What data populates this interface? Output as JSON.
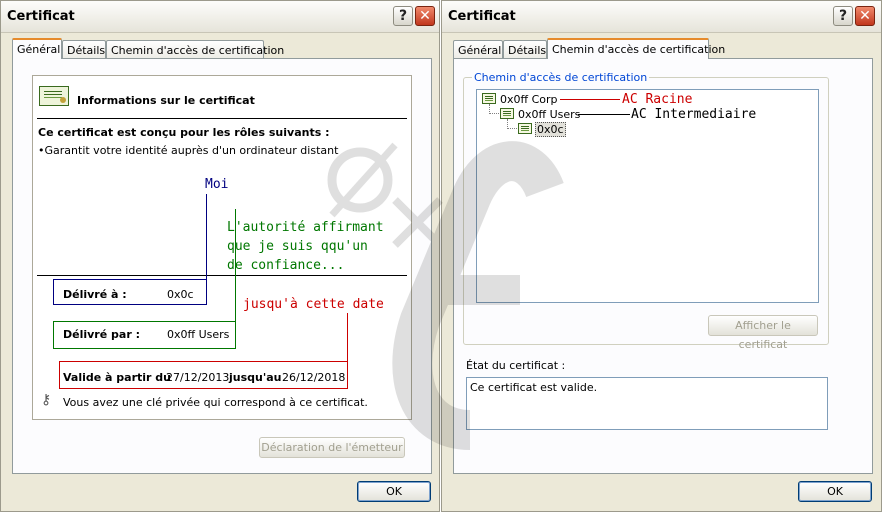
{
  "left_window": {
    "title": "Certificat",
    "tabs": [
      "Général",
      "Détails",
      "Chemin d'accès de certification"
    ],
    "header": "Informations sur le certificat",
    "roles_heading": "Ce certificat est conçu pour les rôles suivants :",
    "role_item": "Garantit votre identité auprès d'un ordinateur distant",
    "issued_to_label": "Délivré à :",
    "issued_to_value": "0x0c",
    "issued_by_label": "Délivré par :",
    "issued_by_value": "0x0ff Users",
    "valid_from_label": "Valide à partir du",
    "valid_from_value": "27/12/2013",
    "valid_to_label": "jusqu'au",
    "valid_to_value": "26/12/2018",
    "private_key_note": "Vous avez une clé privée qui correspond à ce certificat.",
    "issuer_statement_button": "Déclaration de l'émetteur",
    "ok_button": "OK",
    "annotations": {
      "moi": "Moi",
      "authority_line1": "L'autorité affirmant",
      "authority_line2": "que je suis qqu'un",
      "authority_line3": "de confiance...",
      "until_date": "jusqu'à cette date"
    }
  },
  "right_window": {
    "title": "Certificat",
    "tabs": [
      "Général",
      "Détails",
      "Chemin d'accès de certification"
    ],
    "group_label": "Chemin d'accès de certification",
    "tree": [
      "0x0ff Corp",
      "0x0ff Users",
      "0x0c"
    ],
    "view_cert_button": "Afficher le certificat",
    "status_label": "État du certificat :",
    "status_text": "Ce certificat est valide.",
    "ok_button": "OK",
    "annotations": {
      "root_ca": "AC Racine",
      "intermediate_ca": "AC Intermediaire"
    }
  },
  "colors": {
    "annotation_blue": "#000080",
    "annotation_green": "#007700",
    "annotation_red": "#cc0000",
    "tab_accent": "#e68b2c"
  }
}
